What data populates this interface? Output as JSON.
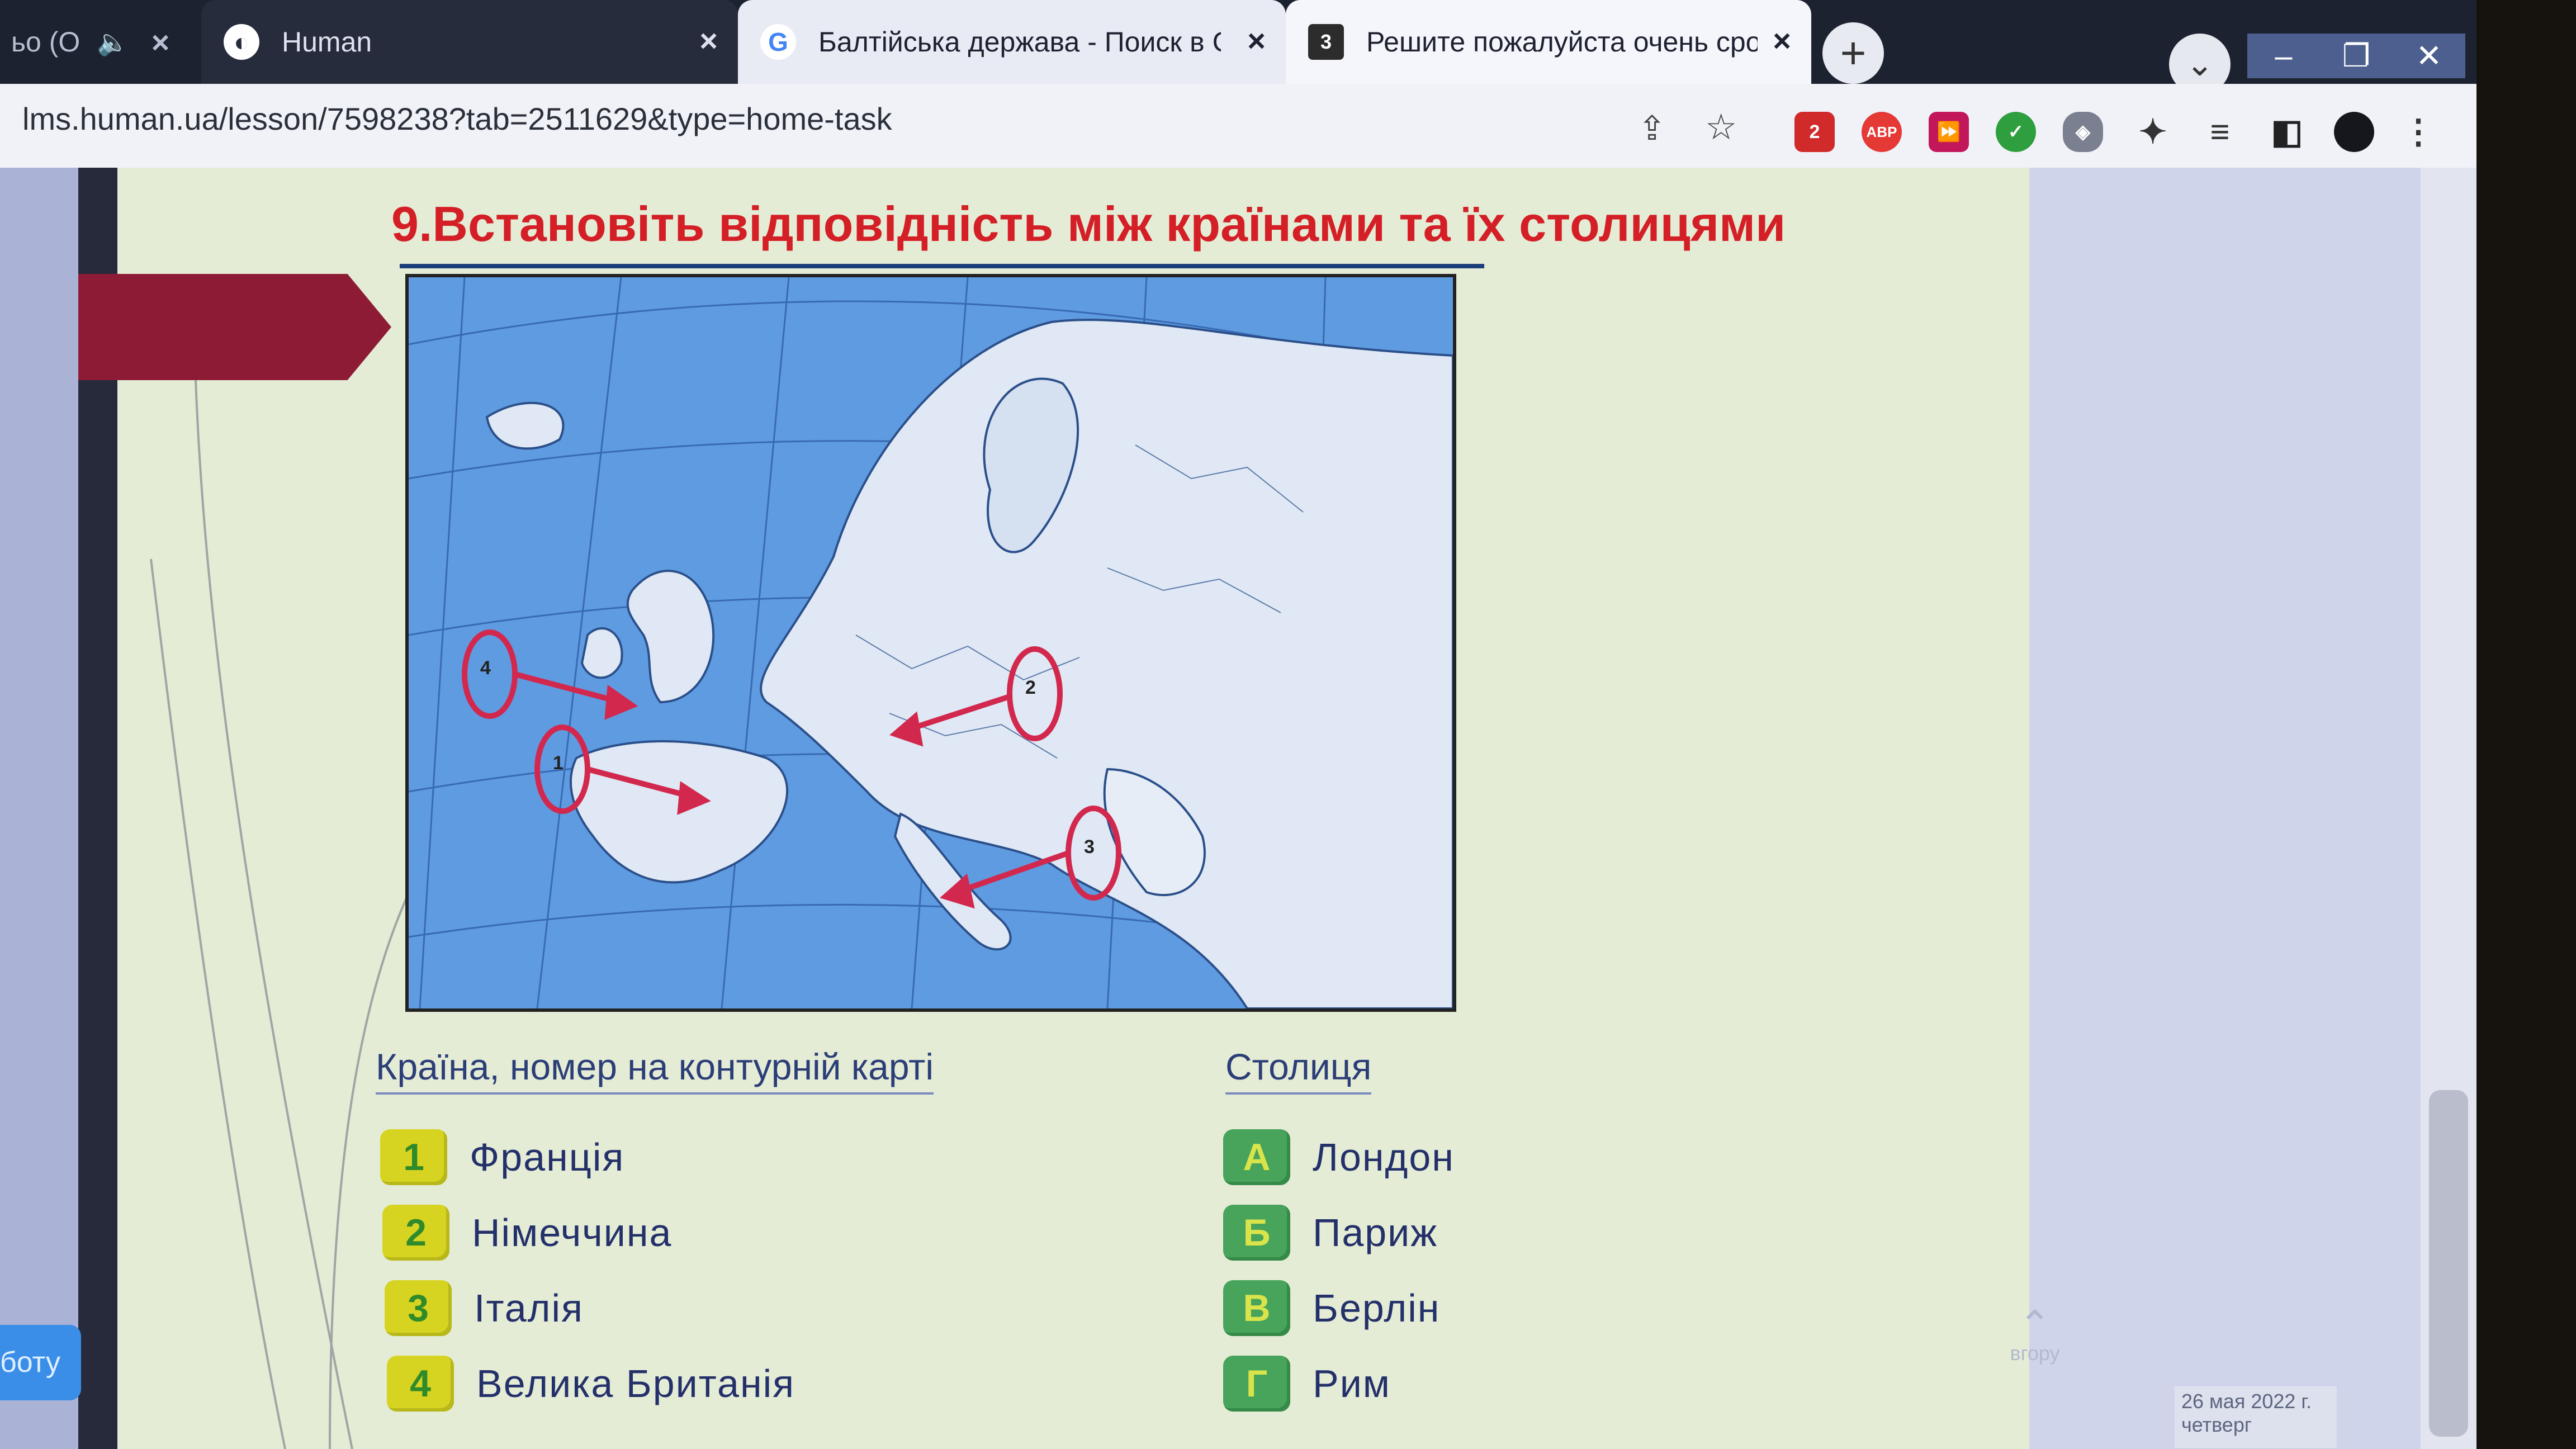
{
  "browser": {
    "tabs": [
      {
        "title": "ьо (О",
        "state": "partial"
      },
      {
        "title": "Human",
        "icon": "human-logo-icon"
      },
      {
        "title": "Балтійська держава - Поиск в Google",
        "icon": "google-icon"
      },
      {
        "title": "Решите пожалуйста очень срочно",
        "icon": "page-3-icon",
        "active": true
      }
    ],
    "url": "lms.human.ua/lesson/7598238?tab=2511629&type=home-task",
    "extension_badge": "2",
    "abp_label": "ABP"
  },
  "task": {
    "title": "9.Встановіть відповідність між країнами та їх столицями",
    "map_labels": [
      "1",
      "2",
      "3",
      "4"
    ],
    "countries_header": "Країна, номер на контурній карті",
    "capitals_header": "Столиця",
    "countries": [
      {
        "num": "1",
        "name": "Франція"
      },
      {
        "num": "2",
        "name": "Німеччина"
      },
      {
        "num": "3",
        "name": "Італія"
      },
      {
        "num": "4",
        "name": "Велика Британія"
      }
    ],
    "capitals": [
      {
        "letter": "А",
        "name": "Лондон"
      },
      {
        "letter": "Б",
        "name": "Париж"
      },
      {
        "letter": "В",
        "name": "Берлін"
      },
      {
        "letter": "Г",
        "name": "Рим"
      }
    ]
  },
  "page": {
    "left_button": "боту",
    "to_top": "вгору",
    "date_line1": "26 мая 2022 г.",
    "date_line2": "четверг"
  },
  "colors": {
    "title_red": "#d41f26",
    "sea": "#5f9be0",
    "land": "#dfe8f4",
    "marker": "#d2284e",
    "number_badge": "#d6d420",
    "letter_badge": "#47a45a"
  }
}
